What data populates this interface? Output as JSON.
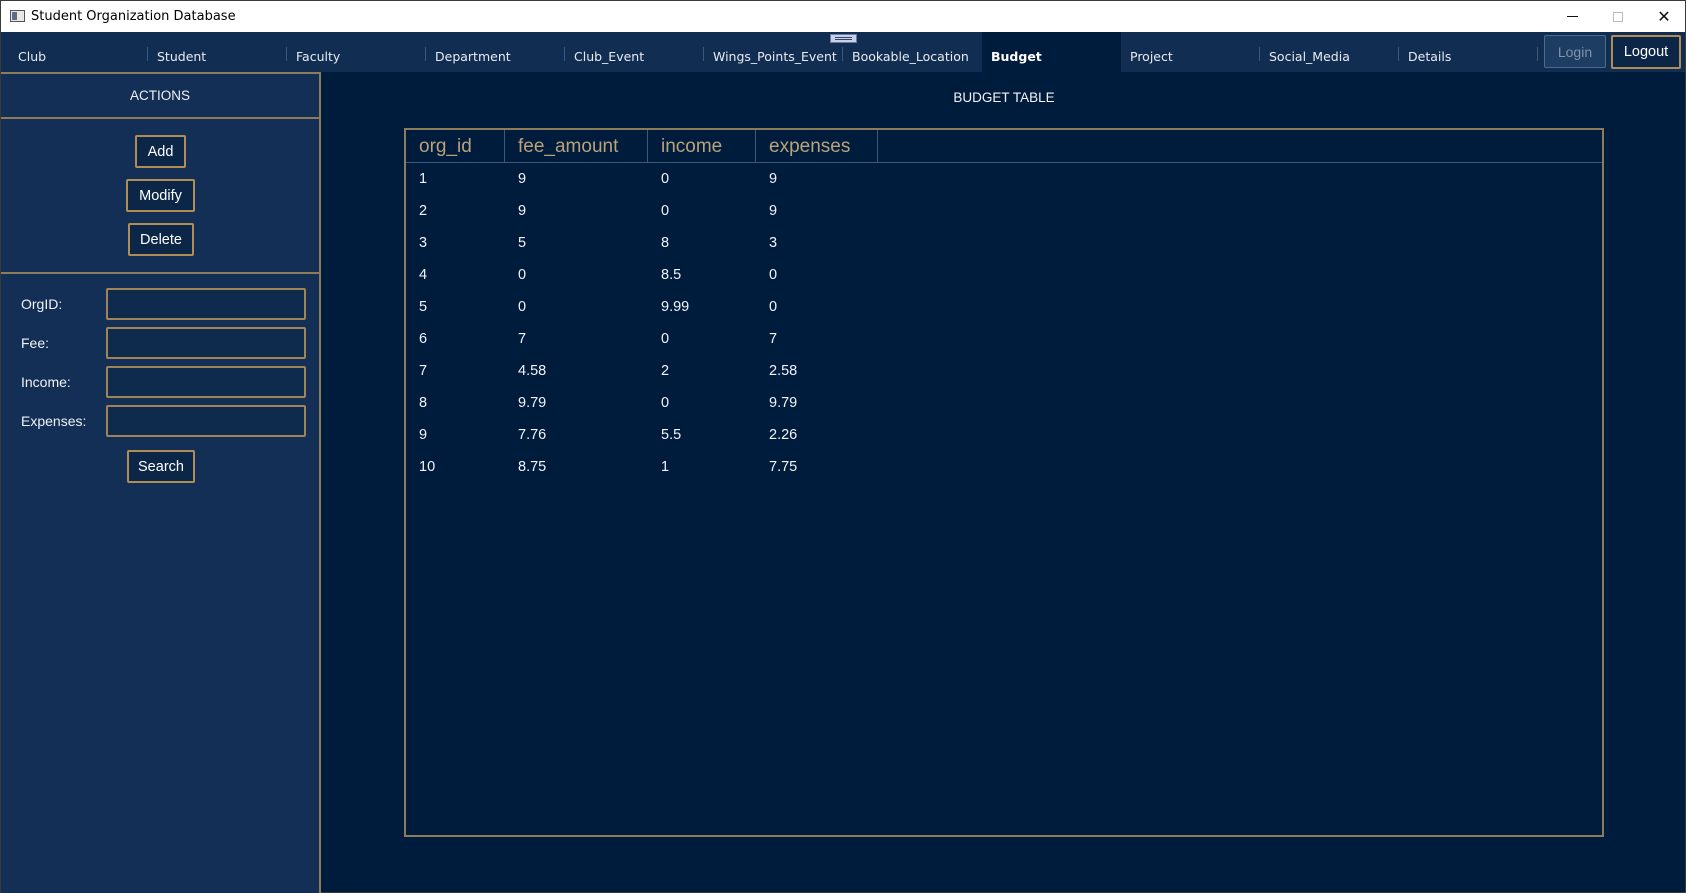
{
  "window": {
    "title": "Student Organization Database"
  },
  "tabs": [
    {
      "label": "Club",
      "active": false
    },
    {
      "label": "Student",
      "active": false
    },
    {
      "label": "Faculty",
      "active": false
    },
    {
      "label": "Department",
      "active": false
    },
    {
      "label": "Club_Event",
      "active": false
    },
    {
      "label": "Wings_Points_Event",
      "active": false
    },
    {
      "label": "Bookable_Location",
      "active": false
    },
    {
      "label": "Budget",
      "active": true
    },
    {
      "label": "Project",
      "active": false
    },
    {
      "label": "Social_Media",
      "active": false
    },
    {
      "label": "Details",
      "active": false
    }
  ],
  "auth": {
    "login_label": "Login",
    "logout_label": "Logout"
  },
  "sidebar": {
    "heading": "ACTIONS",
    "add_label": "Add",
    "modify_label": "Modify",
    "delete_label": "Delete",
    "fields": [
      {
        "label": "OrgID:",
        "value": ""
      },
      {
        "label": "Fee:",
        "value": ""
      },
      {
        "label": "Income:",
        "value": ""
      },
      {
        "label": "Expenses:",
        "value": ""
      }
    ],
    "search_label": "Search"
  },
  "main": {
    "title": "BUDGET TABLE",
    "table": {
      "columns": [
        "org_id",
        "fee_amount",
        "income",
        "expenses"
      ],
      "rows": [
        [
          "1",
          "9",
          "0",
          "9"
        ],
        [
          "2",
          "9",
          "0",
          "9"
        ],
        [
          "3",
          "5",
          "8",
          "3"
        ],
        [
          "4",
          "0",
          "8.5",
          "0"
        ],
        [
          "5",
          "0",
          "9.99",
          "0"
        ],
        [
          "6",
          "7",
          "0",
          "7"
        ],
        [
          "7",
          "4.58",
          "2",
          "2.58"
        ],
        [
          "8",
          "9.79",
          "0",
          "9.79"
        ],
        [
          "9",
          "7.76",
          "5.5",
          "2.26"
        ],
        [
          "10",
          "8.75",
          "1",
          "7.75"
        ]
      ]
    }
  },
  "colors": {
    "background": "#001c3d",
    "panel": "#132f55",
    "accent_gold": "#b08d57",
    "header_text": "#b9a17a"
  }
}
